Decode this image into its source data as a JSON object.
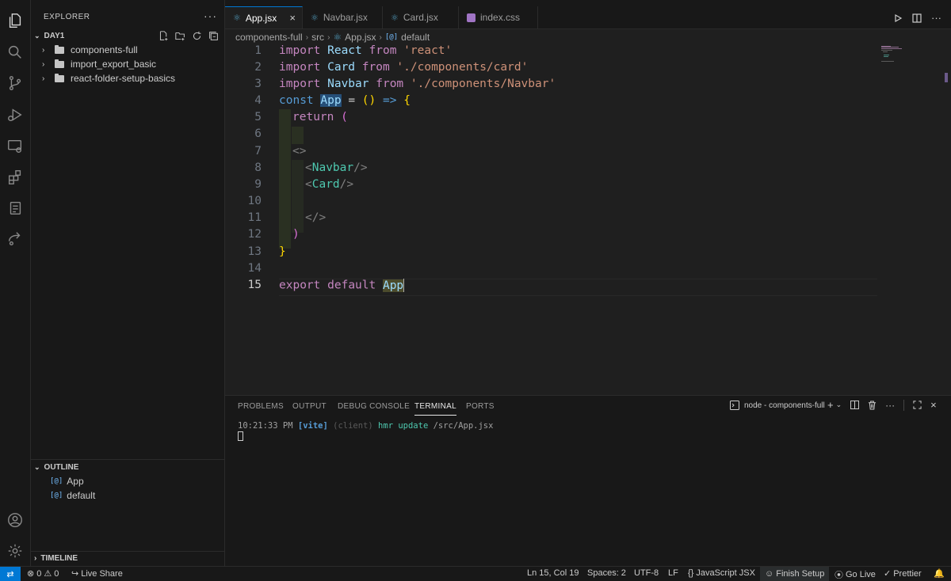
{
  "sidebar": {
    "title": "EXPLORER",
    "root": "DAY1",
    "folders": [
      "components-full",
      "import_export_basic",
      "react-folder-setup-basics"
    ],
    "outline_title": "OUTLINE",
    "outline_items": [
      "App",
      "default"
    ],
    "outline_symbol": "[@]",
    "timeline_title": "TIMELINE"
  },
  "tabs": [
    {
      "label": "App.jsx",
      "active": true
    },
    {
      "label": "Navbar.jsx",
      "active": false
    },
    {
      "label": "Card.jsx",
      "active": false
    },
    {
      "label": "index.css",
      "active": false
    }
  ],
  "breadcrumbs": [
    "components-full",
    "src",
    "App.jsx",
    "default"
  ],
  "editor": {
    "line_numbers": [
      "1",
      "2",
      "3",
      "4",
      "5",
      "6",
      "7",
      "8",
      "9",
      "10",
      "11",
      "12",
      "13",
      "14",
      "15"
    ],
    "current_line": 15,
    "tokens": {
      "l1": [
        "import",
        " React ",
        "from",
        " 'react'"
      ],
      "l2": [
        "import",
        " Card ",
        "from",
        " './components/card'"
      ],
      "l3": [
        "import",
        " Navbar ",
        "from",
        " './components/Navbar'"
      ],
      "l4": [
        "const",
        " ",
        "App",
        " = ",
        "()",
        " ",
        "=>",
        " ",
        "{"
      ],
      "l5": [
        "return",
        " ",
        "("
      ],
      "l7": [
        "<>"
      ],
      "l8": [
        "<",
        "Navbar",
        "/>"
      ],
      "l9": [
        "<",
        "Card",
        "/>"
      ],
      "l11": [
        "</>"
      ],
      "l12": [
        ")"
      ],
      "l13": [
        "}"
      ],
      "l15": [
        "export",
        " ",
        "default",
        " ",
        "App"
      ]
    }
  },
  "panel": {
    "tabs": [
      "PROBLEMS",
      "OUTPUT",
      "DEBUG CONSOLE",
      "TERMINAL",
      "PORTS"
    ],
    "active_tab": "TERMINAL",
    "terminal_name": "node - components-full",
    "terminal_line": {
      "time": "10:21:33 PM",
      "source": "[vite]",
      "client": "(client)",
      "msg": "hmr update",
      "path": "/src/App.jsx"
    }
  },
  "status": {
    "errors": "0",
    "warnings": "0",
    "live_share": "Live Share",
    "position": "Ln 15, Col 19",
    "spaces": "Spaces: 2",
    "encoding": "UTF-8",
    "eol": "LF",
    "language": "JavaScript JSX",
    "finish_setup": "Finish Setup",
    "go_live": "Go Live",
    "prettier": "Prettier"
  },
  "colors": {
    "accent": "#0078d4",
    "keyword": "#c586c0",
    "string": "#ce9178",
    "tag": "#4ec9b0"
  }
}
